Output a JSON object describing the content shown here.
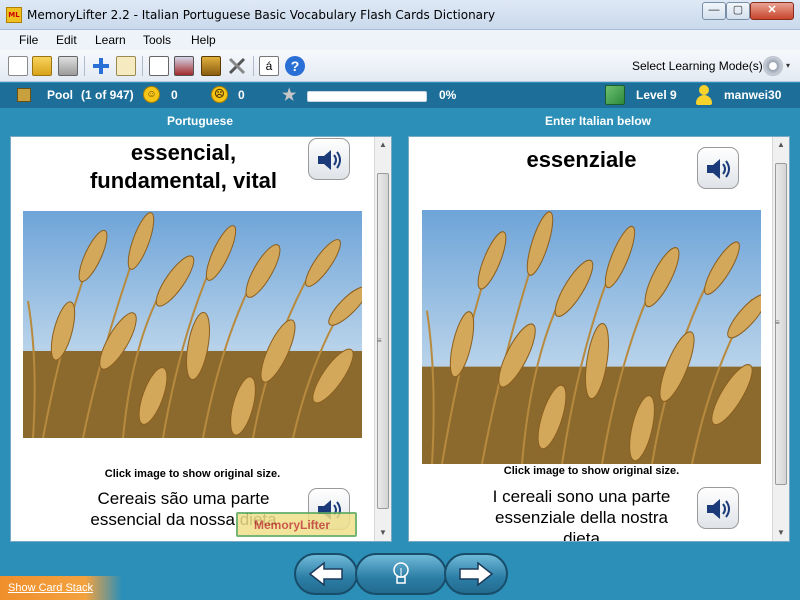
{
  "window": {
    "title": "MemoryLifter 2.2 - Italian Portuguese Basic Vocabulary Flash Cards Dictionary",
    "app_icon_text": "ML",
    "minimize": "—",
    "maximize": "▢",
    "close": "✕"
  },
  "menu": {
    "items": [
      "File",
      "Edit",
      "Learn",
      "Tools",
      "Help"
    ]
  },
  "toolbar": {
    "select_mode_label": "Select Learning Mode(s)",
    "special_char_label": "á",
    "help_label": "?",
    "gear_caret": "▾"
  },
  "status": {
    "pool_label": "Pool",
    "pool_count": "(1 of 947)",
    "happy_count": "0",
    "sad_count": "0",
    "progress_percent": 0,
    "progress_text": "0%",
    "level_text": "Level 9",
    "username": "manwei30"
  },
  "question": {
    "header": "Portuguese",
    "word_line1": "essencial,",
    "word_line2": "fundamental, vital",
    "caption": "Click image to show original size.",
    "sentence_line1": "Cereais são uma parte",
    "sentence_line2": "essencial da nossa dieta"
  },
  "answer": {
    "header": "Enter Italian below",
    "word": "essenziale",
    "caption": "Click image to show original size.",
    "sentence_line1": "I cereali sono una parte",
    "sentence_line2": "essenziale della nostra",
    "sentence_line3": "dieta"
  },
  "watermark": {
    "text": "MemoryLifter"
  },
  "footer": {
    "show_card_stack": "Show Card Stack"
  },
  "colors": {
    "background": "#2b8fb8",
    "statusbar": "#1d6f99",
    "progress_fill": "#7fd06b",
    "show_stack": "#f08e2c"
  }
}
